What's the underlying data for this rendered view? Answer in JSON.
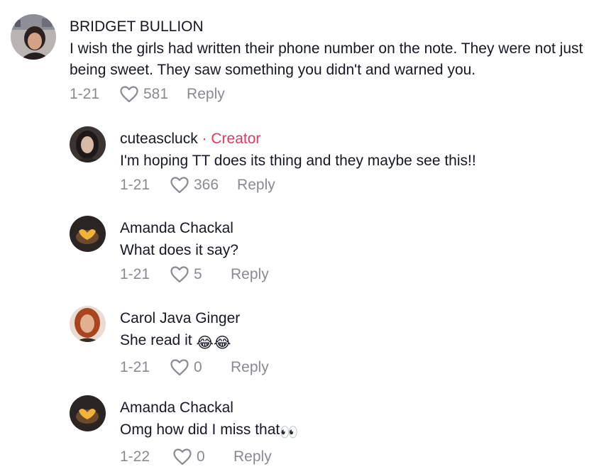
{
  "comments": [
    {
      "username": "BRIDGET BULLION",
      "creator_tag": "",
      "text": "I wish the girls had written their phone number on the note. They were not just being sweet. They saw something you didn't and warned you.",
      "date": "1-21",
      "likes": "581",
      "reply_label": "Reply"
    },
    {
      "username": "cuteascluck",
      "creator_tag": " · Creator",
      "text": "I'm hoping TT does its thing and they maybe see this!!",
      "date": "1-21",
      "likes": "366",
      "reply_label": "Reply"
    },
    {
      "username": "Amanda Chackal",
      "creator_tag": "",
      "text": "What does it say?",
      "date": "1-21",
      "likes": "5",
      "reply_label": "Reply"
    },
    {
      "username": "Carol Java Ginger",
      "creator_tag": "",
      "text": "She read it",
      "text_emoji": "😂😂",
      "date": "1-21",
      "likes": "0",
      "reply_label": "Reply"
    },
    {
      "username": "Amanda Chackal",
      "creator_tag": "",
      "text": "Omg how did I miss that",
      "text_emoji": "👀",
      "date": "1-22",
      "likes": "0",
      "reply_label": "Reply"
    }
  ],
  "icons": {
    "like": "heart-outline-icon"
  },
  "colors": {
    "creator_accent": "#e0395f",
    "meta_gray": "#8a8b91",
    "text": "#161823"
  }
}
